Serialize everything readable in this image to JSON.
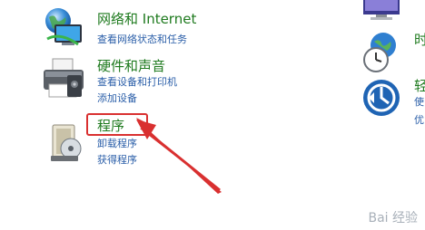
{
  "categories": [
    {
      "title": "网络和 Internet",
      "links": [
        "查看网络状态和任务"
      ]
    },
    {
      "title": "硬件和声音",
      "links": [
        "查看设备和打印机",
        "添加设备"
      ]
    },
    {
      "title": "程序",
      "links": [
        "卸载程序",
        "获得程序"
      ]
    }
  ],
  "right_column": {
    "title_partial_1": "时",
    "title_partial_2": "轻",
    "link_partial_1": "使",
    "link_partial_2": "优"
  },
  "watermark": "Bai 经验",
  "colors": {
    "title_green": "#1e7a1e",
    "link_blue": "#2a5ea8",
    "annotation_red": "#d93030"
  },
  "icons": [
    "network-icon",
    "printer-icon",
    "programs-icon",
    "clock-globe-icon",
    "accessibility-icon",
    "monitor-icon"
  ]
}
